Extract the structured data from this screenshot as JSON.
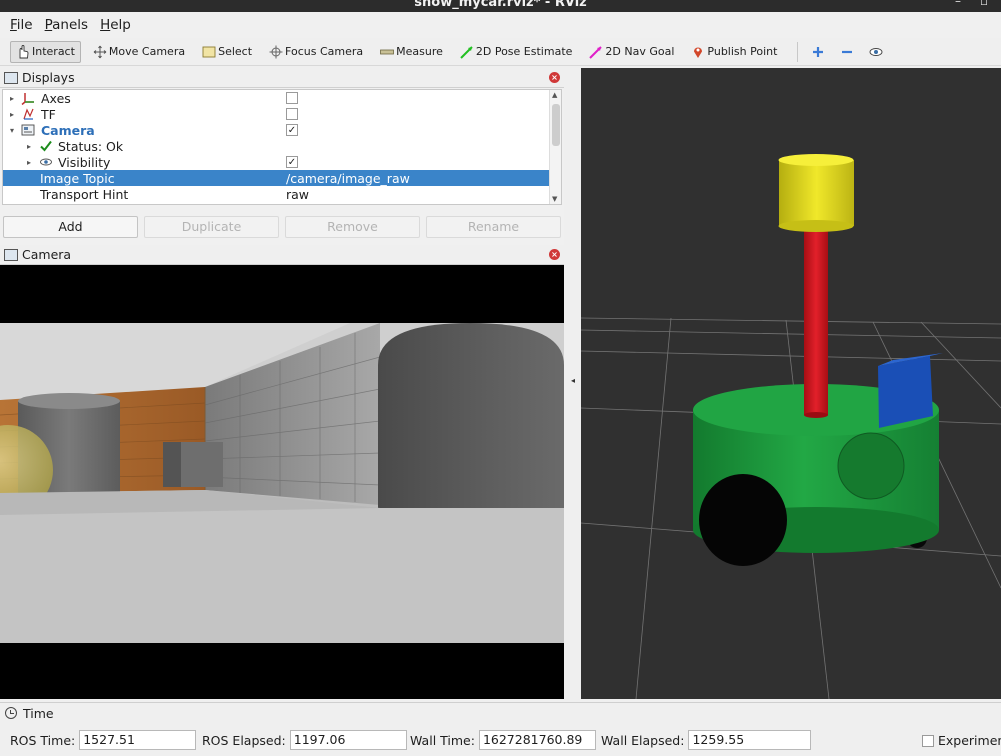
{
  "window": {
    "title": "show_mycar.rviz* - RViz",
    "controls": [
      "–",
      "▫"
    ]
  },
  "menu": [
    {
      "accel": "F",
      "rest": "ile"
    },
    {
      "accel": "P",
      "rest": "anels"
    },
    {
      "accel": "H",
      "rest": "elp"
    }
  ],
  "toolbar": {
    "interact": "Interact",
    "move_camera": "Move Camera",
    "select": "Select",
    "focus_camera": "Focus Camera",
    "measure": "Measure",
    "pose_estimate": "2D Pose Estimate",
    "nav_goal": "2D Nav Goal",
    "publish_point": "Publish Point"
  },
  "displays": {
    "title": "Displays",
    "rows": [
      {
        "label": "Axes",
        "checked": false,
        "icon": "axes-icon"
      },
      {
        "label": "TF",
        "checked": false,
        "icon": "tf-icon"
      },
      {
        "label": "Camera",
        "checked": true,
        "icon": "camera-display-icon"
      },
      {
        "label": "Status: Ok",
        "icon": "check-icon"
      },
      {
        "label": "Visibility",
        "checked": true,
        "icon": "eye-icon"
      },
      {
        "label": "Image Topic",
        "value": "/camera/image_raw"
      },
      {
        "label": "Transport Hint",
        "value": "raw"
      }
    ],
    "buttons": {
      "add": "Add",
      "duplicate": "Duplicate",
      "remove": "Remove",
      "rename": "Rename"
    }
  },
  "camera_panel": {
    "title": "Camera"
  },
  "time": {
    "title": "Time",
    "ros_time_label": "ROS Time:",
    "ros_time": "1527.51",
    "ros_elapsed_label": "ROS Elapsed:",
    "ros_elapsed": "1197.06",
    "wall_time_label": "Wall Time:",
    "wall_time": "1627281760.89",
    "wall_elapsed_label": "Wall Elapsed:",
    "wall_elapsed": "1259.55",
    "experimental": "Experimen"
  },
  "colors": {
    "selection": "#3a84c9",
    "view_background": "#303030",
    "robot_base": "#1f9a3e",
    "mast": "#c8141b",
    "camera_top": "#e1d91c",
    "lidar_box": "#1a4fb6"
  }
}
